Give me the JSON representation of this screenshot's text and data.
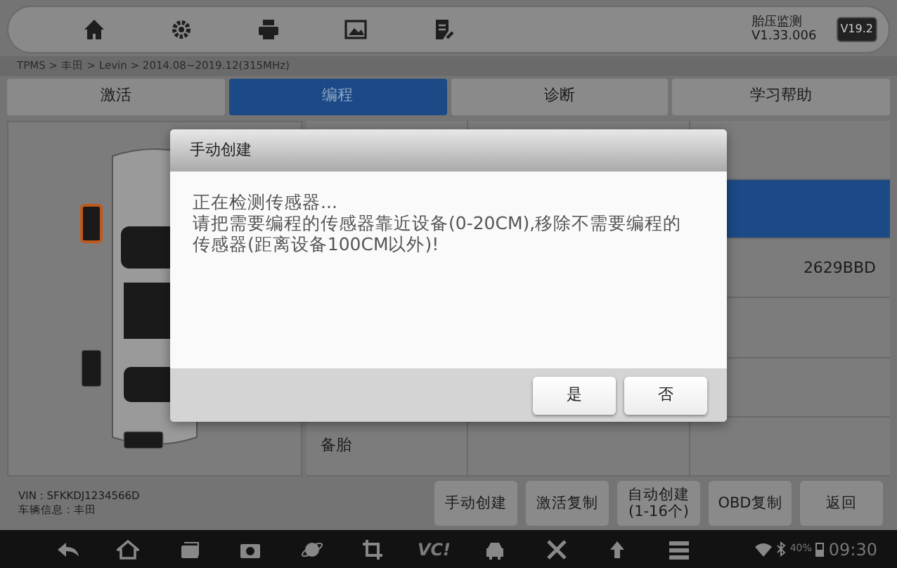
{
  "toolbar": {
    "app_name": "胎压监测",
    "version": "V1.33.006",
    "badge": "V19.2"
  },
  "breadcrumb": "TPMS > 丰田 > Levin > 2014.08~2019.12(315MHz)",
  "tabs": [
    {
      "label": "激活",
      "selected": false
    },
    {
      "label": "编程",
      "selected": true
    },
    {
      "label": "诊断",
      "selected": false
    },
    {
      "label": "学习帮助",
      "selected": false
    }
  ],
  "wheels": [
    {
      "selected": true
    },
    {
      "selected": false
    },
    {
      "selected": false
    }
  ],
  "table": {
    "rows": [
      {
        "selected": false
      },
      {
        "selected": true
      },
      {
        "selected": false,
        "column_3": "2629BBD"
      },
      {
        "selected": false
      },
      {
        "selected": false
      },
      {
        "selected": false,
        "column_1": "备胎"
      }
    ]
  },
  "vehicle": {
    "vin": "VIN : SFKKDJ1234566D",
    "info": "车辆信息 : 丰田"
  },
  "actions": [
    {
      "label": "手动创建"
    },
    {
      "label": "激活复制"
    },
    {
      "label": "自动创建",
      "sub": "(1-16个)"
    },
    {
      "label": "OBD复制"
    },
    {
      "label": "返回"
    }
  ],
  "dialog": {
    "title": "手动创建",
    "lines": [
      "正在检测传感器...",
      "请把需要编程的传感器靠近设备(0-20CM),移除不需要编程的传感器(距离设备100CM以外)!"
    ],
    "buttons": [
      "是",
      "否"
    ]
  },
  "system_bar": {
    "vci": "VC!",
    "battery": "40%",
    "time": "09:30"
  }
}
